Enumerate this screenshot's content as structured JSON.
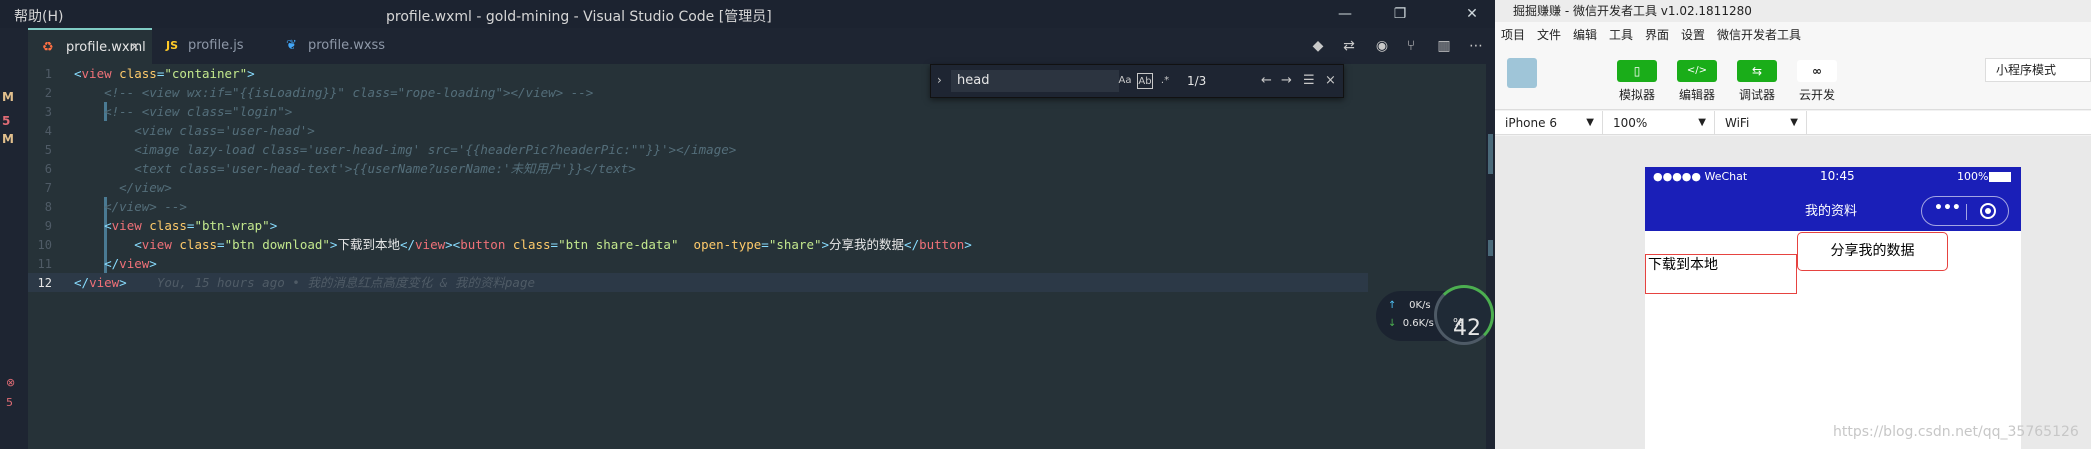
{
  "vscode": {
    "menu_label": "帮助(H)",
    "window_title": "profile.wxml - gold-mining - Visual Studio Code [管理员]",
    "tabs": [
      {
        "icon": "♻",
        "label": "profile.wxml",
        "close": "×"
      },
      {
        "icon": "JS",
        "label": "profile.js"
      },
      {
        "icon": "❦",
        "label": "profile.wxss"
      }
    ],
    "gutter_marks": [
      "M",
      "5",
      "M"
    ],
    "error_marks": [
      "⊗",
      "5"
    ],
    "find": {
      "value": "head",
      "case_label": "Aa",
      "word_label": "Ab",
      "regex_label": ".*",
      "count": "1/3",
      "prev": "←",
      "next": "→",
      "close": "×"
    },
    "lines": [
      {
        "n": "1"
      },
      {
        "n": "2"
      },
      {
        "n": "3"
      },
      {
        "n": "4"
      },
      {
        "n": "5"
      },
      {
        "n": "6"
      },
      {
        "n": "7"
      },
      {
        "n": "8"
      },
      {
        "n": "9"
      },
      {
        "n": "10"
      },
      {
        "n": "11"
      },
      {
        "n": "12"
      }
    ],
    "code": {
      "l1": [
        "<",
        "view",
        " ",
        "class",
        "=",
        "\"container\"",
        ">"
      ],
      "l2": "<!-- <view wx:if=\"{{isLoading}}\" class=\"rope-loading\"></view> -->",
      "l3": "<!-- <view class=\"login\">",
      "l4": "<view class='user-head'>",
      "l5": "<image lazy-load class='user-head-img' src='{{headerPic?headerPic:\"\"}}'></image>",
      "l6": "<text class='user-head-text'>{{userName?userName:'未知用户'}}</text>",
      "l7": "</view>",
      "l8": "</view> -->",
      "l9": [
        "<",
        "view",
        " ",
        "class",
        "=",
        "\"btn-wrap\"",
        ">"
      ],
      "l10_a": [
        "<",
        "view",
        " ",
        "class",
        "=",
        "\"btn download\"",
        ">"
      ],
      "l10_text1": "下载到本地",
      "l10_b": [
        "</",
        "view",
        ">",
        "<",
        "button",
        " ",
        "class",
        "=",
        "\"btn share-data\"",
        "  ",
        "open-type",
        "=",
        "\"share\"",
        ">"
      ],
      "l10_text2": "分享我的数据",
      "l10_c": [
        "</",
        "button",
        ">"
      ],
      "l11": [
        "</",
        "view",
        ">"
      ],
      "l12": [
        "</",
        "view",
        ">"
      ],
      "ghost": "You, 15 hours ago • 我的消息红点高度变化 & 我的资料page"
    },
    "speed": {
      "up": "0K/s",
      "down": "0.6K/s",
      "up_arrow": "↑",
      "down_arrow": "↓"
    },
    "gauge_value": "42",
    "gauge_unit": "%"
  },
  "wechat": {
    "title": "掘掘赚赚 - 微信开发者工具 v1.02.1811280",
    "menu": [
      "项目",
      "文件",
      "编辑",
      "工具",
      "界面",
      "设置",
      "微信开发者工具"
    ],
    "toolbar": [
      {
        "label": "模拟器",
        "icon": "▯"
      },
      {
        "label": "编辑器",
        "icon": "</>"
      },
      {
        "label": "调试器",
        "icon": "⇆"
      },
      {
        "label": "云开发",
        "icon": "∞"
      }
    ],
    "mode": "小程序模式",
    "device": "iPhone 6",
    "zoom": "100%",
    "network": "WiFi",
    "phone": {
      "carrier": "●●●●● WeChat",
      "time": "10:45",
      "battery": "100%",
      "nav_title": "我的资料",
      "download_text": "下载到本地",
      "share_text": "分享我的数据"
    },
    "watermark": "https://blog.csdn.net/qq_35765126"
  }
}
